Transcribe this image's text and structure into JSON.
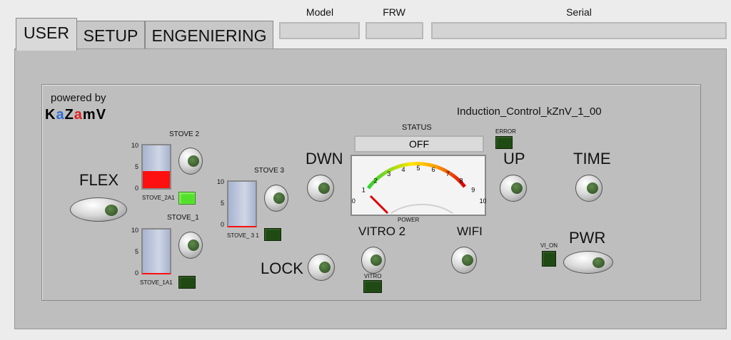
{
  "tabs": [
    {
      "label": "USER"
    },
    {
      "label": "SETUP"
    },
    {
      "label": "ENGENIERING"
    }
  ],
  "header": {
    "model_label": "Model",
    "frw_label": "FRW",
    "serial_label": "Serial",
    "model_value": "",
    "frw_value": "",
    "serial_value": ""
  },
  "brand": {
    "powered_by": "powered by",
    "logo_chars": [
      "K",
      "a",
      "Z",
      "a",
      "m",
      "V"
    ],
    "logo_colors": [
      "#000000",
      "#2e6fd8",
      "#000000",
      "#e02020",
      "#000000",
      "#000000"
    ]
  },
  "app_title": "Induction_Control_kZnV_1_00",
  "controls": {
    "flex": "FLEX",
    "dwn": "DWN",
    "lock": "LOCK",
    "vitro2": "VITRO 2",
    "wifi": "WIFI",
    "up": "UP",
    "time": "TIME",
    "pwr": "PWR",
    "stove2": "STOVE 2",
    "stove1": "STOVE_1",
    "stove3": "STOVE 3",
    "stove2a_led": "STOVE_2A1",
    "stove1a_led": "STOVE_1A1",
    "stove3_led": "STOVE_ 3 1",
    "vitro_led": "VITRO",
    "error_led": "ERROR",
    "vi_on_led": "VI_ON"
  },
  "tank_ticks": [
    "10",
    "5",
    "0"
  ],
  "tanks": {
    "stove2": {
      "level": 4
    },
    "stove1": {
      "level": 0
    },
    "stove3": {
      "level": 0
    }
  },
  "status": {
    "label": "STATUS",
    "value": "OFF"
  },
  "gauge": {
    "label": "POWER",
    "min": 0,
    "max": 10,
    "value": 0,
    "ticks": [
      "0",
      "1",
      "2",
      "3",
      "4",
      "5",
      "6",
      "7",
      "8",
      "9",
      "10"
    ]
  },
  "leds": {
    "stove2a": true,
    "stove1a": false,
    "stove3": false,
    "vitro": false,
    "error": false,
    "vi_on": false
  }
}
